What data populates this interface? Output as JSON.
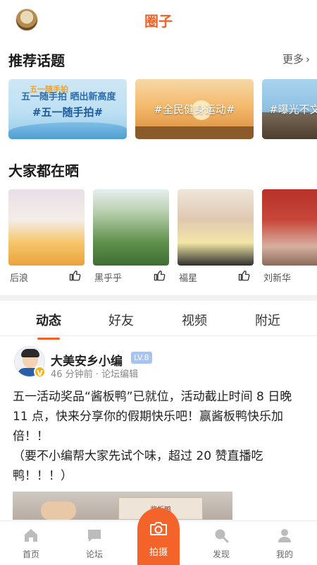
{
  "header": {
    "title": "圈子",
    "avatar_icon": "dog-avatar"
  },
  "topics_section": {
    "title": "推荐话题",
    "more_label": "更多",
    "items": [
      {
        "label": "#五一随手拍#",
        "tag": "五一随手拍",
        "sub": "五一随手拍 晒出新高度"
      },
      {
        "label": "#全民健身运动#"
      },
      {
        "label": "#曝光不文"
      }
    ]
  },
  "photos_section": {
    "title": "大家都在晒",
    "items": [
      {
        "user": "后浪"
      },
      {
        "user": "黑乎乎"
      },
      {
        "user": "福星"
      },
      {
        "user": "刘新华"
      }
    ]
  },
  "feed_tabs": [
    {
      "label": "动态",
      "active": true
    },
    {
      "label": "好友",
      "active": false
    },
    {
      "label": "视频",
      "active": false
    },
    {
      "label": "附近",
      "active": false
    }
  ],
  "post": {
    "author": "大美安乡小编",
    "level": "LV.8",
    "meta": "46 分钟前 · 论坛编辑",
    "body_line1": "五一活动奖品“酱板鸭”已就位，活动截止时间 8 日晚 11 点，快来分享你的假期快乐吧！赢酱板鸭快乐加倍！！",
    "body_line2": "（要不小编帮大家先试个味，超过 20 赞直播吃鸭！！！）",
    "image_text": "酱板鸭"
  },
  "tabbar": {
    "items": [
      {
        "label": "首页",
        "icon": "home-icon"
      },
      {
        "label": "论坛",
        "icon": "chat-icon"
      },
      {
        "label": "拍摄",
        "icon": "camera-icon"
      },
      {
        "label": "发现",
        "icon": "search-icon"
      },
      {
        "label": "我的",
        "icon": "user-icon"
      }
    ]
  },
  "colors": {
    "accent": "#f0622a",
    "capture": "#f3632a",
    "level_badge": "#a9c3ef",
    "verified": "#f5b51e"
  }
}
